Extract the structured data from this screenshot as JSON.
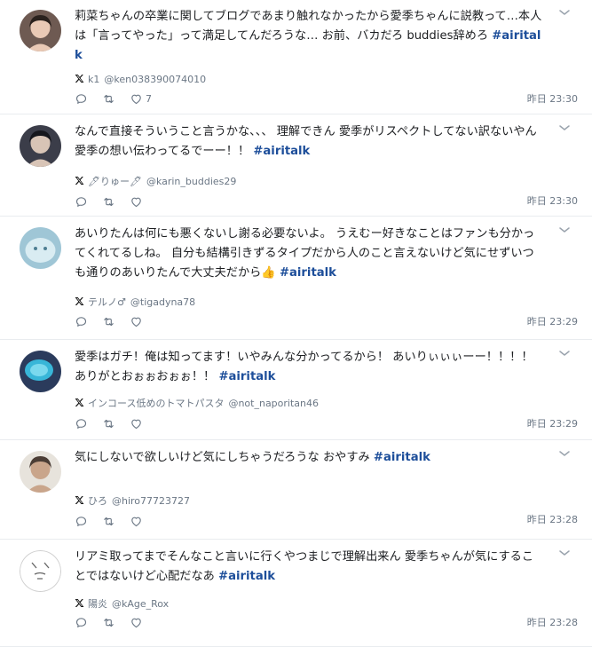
{
  "posts": [
    {
      "text": "莉菜ちゃんの卒業に関してブログであまり触れなかったから愛季ちゃんに説教って…本人は「言ってやった」って満足してんだろうな… お前、バカだろ buddies辞めろ ",
      "hashtag": "#airitalk",
      "author_name": "k1",
      "author_handle": "@ken038390074010",
      "like_count": "7",
      "time": "昨日 23:30",
      "avatar_icon": "profile-photo"
    },
    {
      "text": "なんで直接そういうこと言うかな、、、 理解できん 愛季がリスペクトしてない訳ないやん 愛季の想い伝わってるでーー！！ ",
      "hashtag": "#airitalk",
      "author_name": "🖊りゅー🖊",
      "author_handle": "@karin_buddies29",
      "like_count": "",
      "time": "昨日 23:30",
      "avatar_icon": "profile-photo"
    },
    {
      "text": "あいりたんは何にも悪くないし謝る必要ないよ。 うえむー好きなことはファンも分かってくれてるしね。 自分も結構引きずるタイプだから人のこと言えないけど気にせずいつも通りのあいりたんで大丈夫だから👍 ",
      "hashtag": "#airitalk",
      "author_name": "テルノ♂",
      "author_handle": "@tigadyna78",
      "like_count": "",
      "time": "昨日 23:29",
      "avatar_icon": "profile-photo"
    },
    {
      "text": "愛季はガチ！俺は知ってます！いやみんな分かってるから！ あいりぃぃぃーー！！！！ ありがとおぉぉおぉぉ！！ ",
      "hashtag": "#airitalk",
      "author_name": "インコース低めのトマトパスタ",
      "author_handle": "@not_naporitan46",
      "like_count": "",
      "time": "昨日 23:29",
      "avatar_icon": "profile-photo"
    },
    {
      "text": "気にしないで欲しいけど気にしちゃうだろうな おやすみ ",
      "hashtag": "#airitalk",
      "author_name": "ひろ",
      "author_handle": "@hiro77723727",
      "like_count": "",
      "time": "昨日 23:28",
      "avatar_icon": "profile-photo"
    },
    {
      "text": "リアミ取ってまでそんなこと言いに行くやつまじで理解出来ん 愛季ちゃんが気にすることではないけど心配だなあ ",
      "hashtag": "#airitalk",
      "author_name": "陽炎",
      "author_handle": "@kAge_Rox",
      "like_count": "",
      "time": "昨日 23:28",
      "avatar_icon": "profile-photo"
    }
  ],
  "colors": {
    "hashtag": "#1d4e9a",
    "meta": "#6b7785",
    "divider": "#e9ecef"
  },
  "icons": {
    "platform": "x-logo-icon",
    "reply": "reply-icon",
    "repost": "repost-icon",
    "like": "heart-icon",
    "menu": "chevron-down-icon"
  }
}
